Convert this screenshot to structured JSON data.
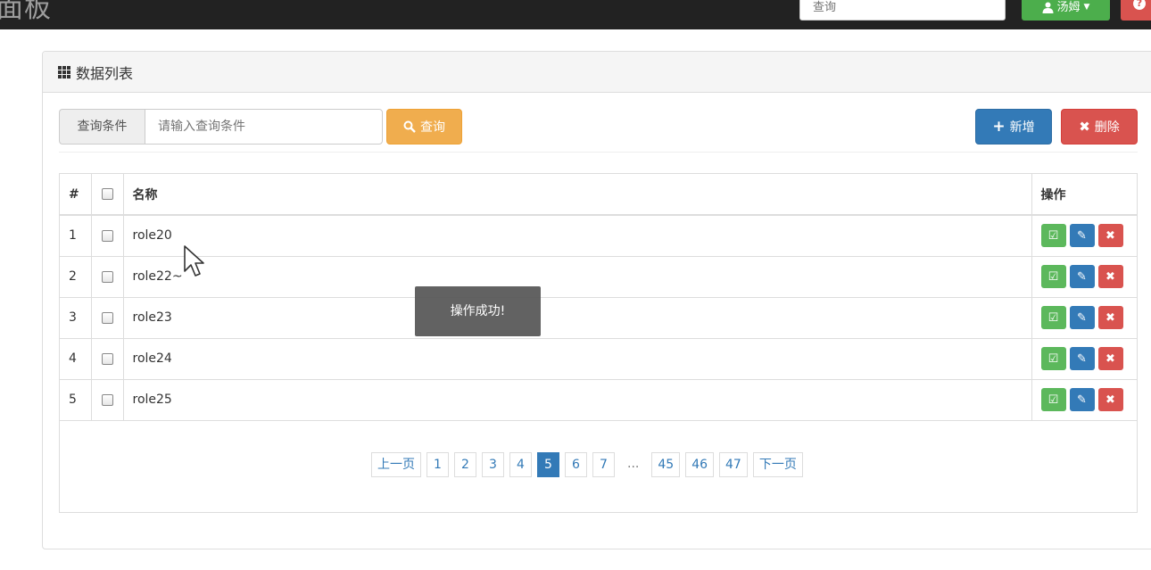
{
  "navbar": {
    "brand": "面板",
    "search_placeholder": "查询",
    "user_label": "汤姆",
    "help_label": "?"
  },
  "panel": {
    "title": "数据列表",
    "query_addon": "查询条件",
    "query_placeholder": "请输入查询条件",
    "query_button": "查询",
    "add_button": "新增",
    "delete_button": "删除"
  },
  "table": {
    "headers": {
      "num": "#",
      "name": "名称",
      "ops": "操作"
    },
    "rows": [
      {
        "num": "1",
        "name": "role20"
      },
      {
        "num": "2",
        "name": "role22~"
      },
      {
        "num": "3",
        "name": "role23"
      },
      {
        "num": "4",
        "name": "role24"
      },
      {
        "num": "5",
        "name": "role25"
      }
    ]
  },
  "pagination": {
    "prev": "上一页",
    "next": "下一页",
    "ellipsis": "...",
    "pages": [
      "1",
      "2",
      "3",
      "4",
      "5",
      "6",
      "7",
      "45",
      "46",
      "47"
    ],
    "current": "5"
  },
  "toast": {
    "message": "操作成功!"
  },
  "colors": {
    "primary": "#337ab7",
    "success": "#5cb85c",
    "warning": "#f0ad4e",
    "danger": "#d9534f",
    "navbar": "#222222"
  }
}
